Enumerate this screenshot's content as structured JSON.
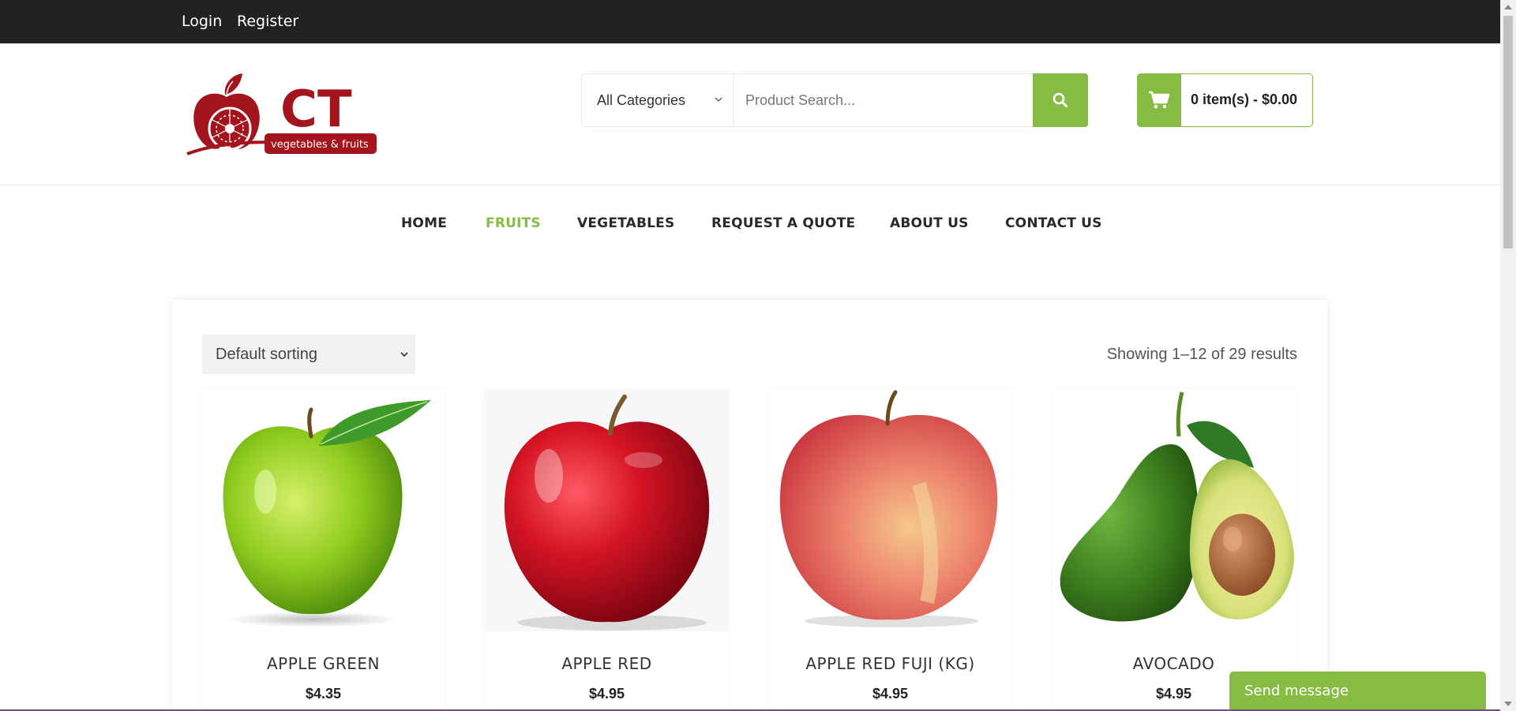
{
  "topbar": {
    "login": "Login",
    "register": "Register"
  },
  "logo": {
    "brand": "CT",
    "tagline": "vegetables & fruits",
    "colors": {
      "primary": "#a3141d"
    }
  },
  "search": {
    "category": "All Categories",
    "placeholder": "Product Search...",
    "button_icon": "search-icon"
  },
  "cart": {
    "label": "0 item(s) - $0.00",
    "icon": "cart-icon"
  },
  "nav": {
    "items": [
      {
        "label": "HOME",
        "active": false
      },
      {
        "label": "FRUITS",
        "active": true
      },
      {
        "label": "VEGETABLES",
        "active": false
      },
      {
        "label": "REQUEST A QUOTE",
        "active": false
      },
      {
        "label": "ABOUT US",
        "active": false
      },
      {
        "label": "CONTACT US",
        "active": false
      }
    ]
  },
  "shop": {
    "sort": "Default sorting",
    "results": "Showing 1–12 of 29 results",
    "products": [
      {
        "name": "APPLE GREEN",
        "price": "$4.35"
      },
      {
        "name": "APPLE RED",
        "price": "$4.95"
      },
      {
        "name": "APPLE RED FUJI (KG)",
        "price": "$4.95"
      },
      {
        "name": "AVOCADO",
        "price": "$4.95"
      }
    ]
  },
  "chat": {
    "label": "Send message"
  },
  "colors": {
    "accent": "#86bc42",
    "topbar": "#222222",
    "brand_red": "#a3141d"
  }
}
